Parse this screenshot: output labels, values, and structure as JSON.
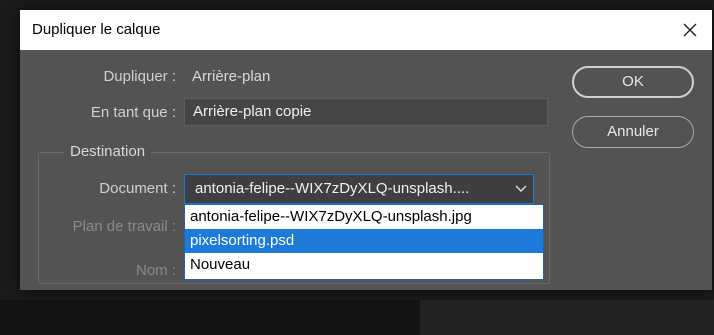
{
  "dialog": {
    "title": "Dupliquer le calque",
    "duplicate_label": "Dupliquer :",
    "duplicate_value": "Arrière-plan",
    "as_label": "En tant que :",
    "as_value": "Arrière-plan copie",
    "destination_legend": "Destination",
    "document_label": "Document :",
    "document_selected": "antonia-felipe--WIX7zDyXLQ-unsplash....",
    "document_options": [
      "antonia-felipe--WIX7zDyXLQ-unsplash.jpg",
      "pixelsorting.psd",
      "Nouveau"
    ],
    "artboard_label": "Plan de travail :",
    "name_label": "Nom :",
    "ok_label": "OK",
    "cancel_label": "Annuler"
  },
  "icons": {
    "close": "close-icon",
    "chevron": "chevron-down-icon"
  },
  "colors": {
    "accent": "#1e7ad8",
    "dialog_bg": "#535353",
    "titlebar": "#ffffff"
  }
}
